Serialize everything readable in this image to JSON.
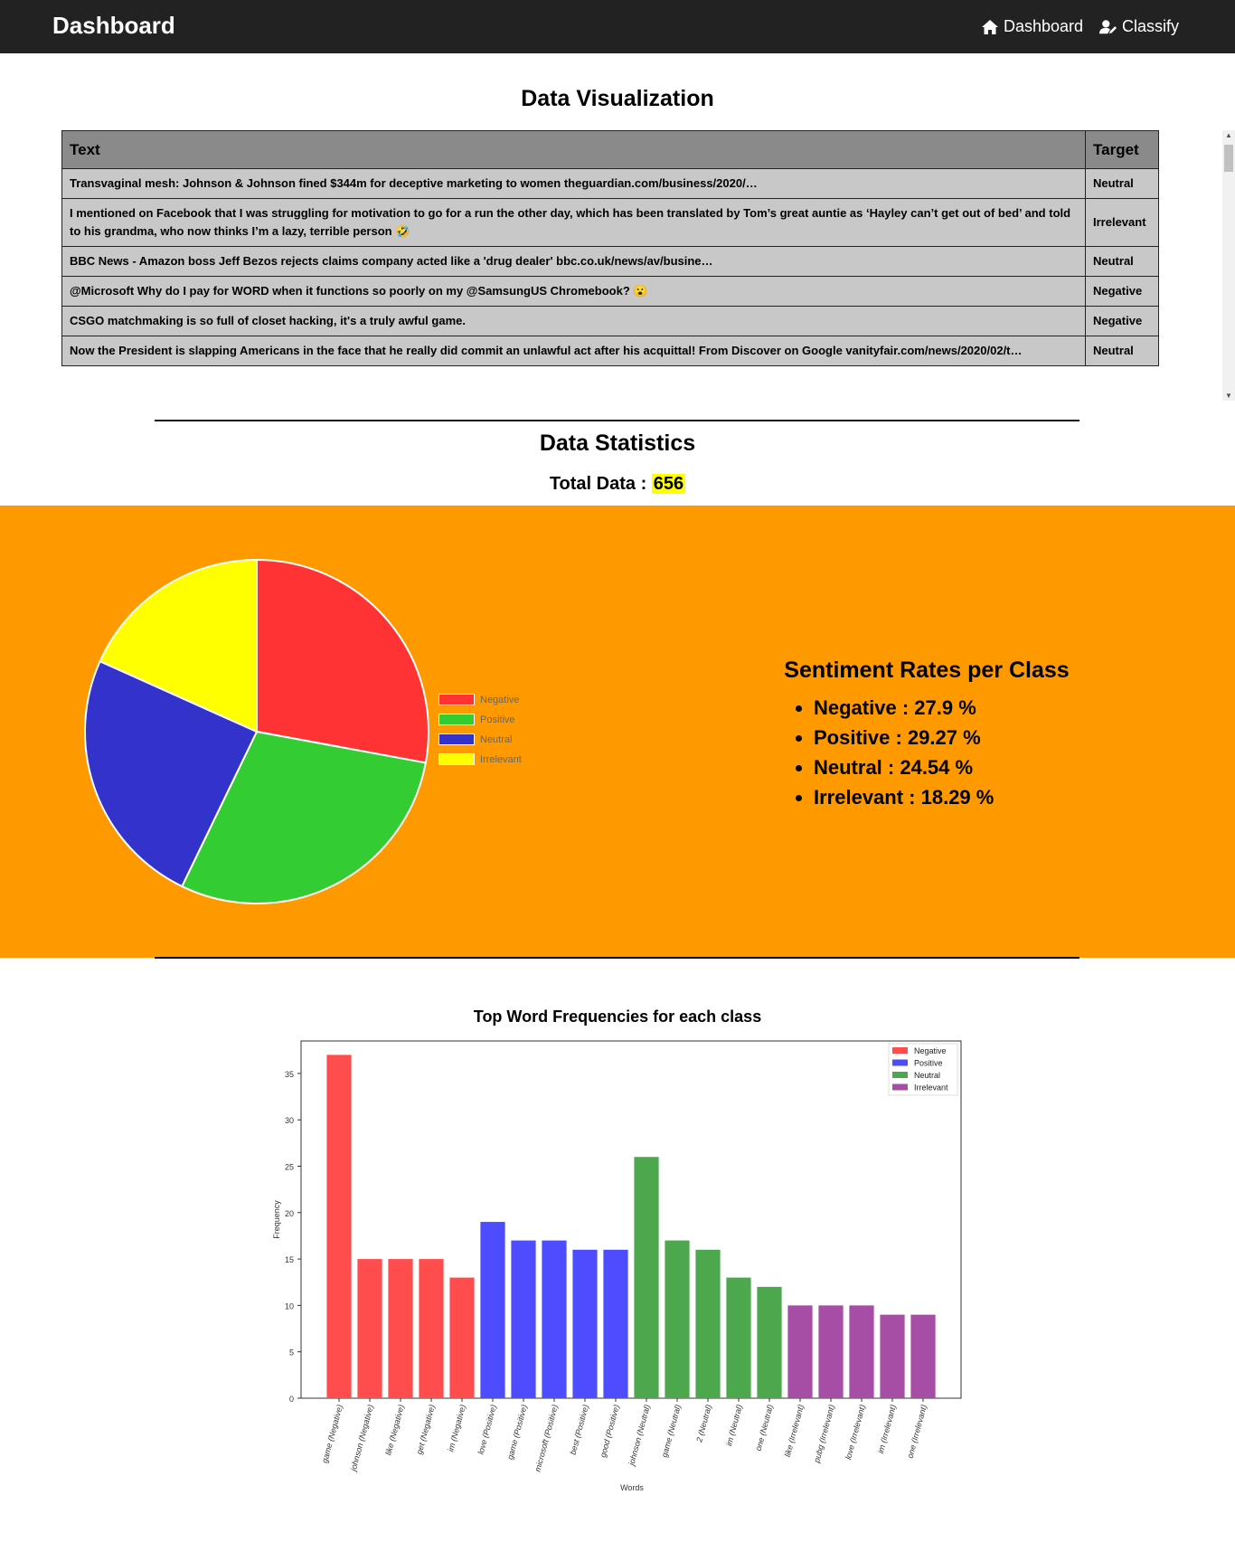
{
  "nav": {
    "brand": "Dashboard",
    "links": [
      {
        "label": "Dashboard",
        "icon": "home-icon"
      },
      {
        "label": "Classify",
        "icon": "user-edit-icon"
      }
    ]
  },
  "viz": {
    "title": "Data Visualization",
    "columns": [
      "Text",
      "Target"
    ],
    "rows": [
      {
        "text": "Transvaginal mesh: Johnson & Johnson fined $344m for deceptive marketing to women theguardian.com/business/2020/…",
        "target": "Neutral"
      },
      {
        "text": "I mentioned on Facebook that I was struggling for motivation to go for a run the other day, which has been translated by Tom’s great auntie as ‘Hayley can’t get out of bed’ and told to his grandma, who now thinks I’m a lazy, terrible person 🤣",
        "target": "Irrelevant"
      },
      {
        "text": "BBC News - Amazon boss Jeff Bezos rejects claims company acted like a 'drug dealer' bbc.co.uk/news/av/busine…",
        "target": "Neutral"
      },
      {
        "text": "@Microsoft Why do I pay for WORD when it functions so poorly on my @SamsungUS Chromebook? 😮",
        "target": "Negative"
      },
      {
        "text": "CSGO matchmaking is so full of closet hacking, it's a truly awful game.",
        "target": "Negative"
      },
      {
        "text": "Now the President is slapping Americans in the face that he really did commit an unlawful act after his acquittal! From Discover on Google vanityfair.com/news/2020/02/t…",
        "target": "Neutral"
      }
    ]
  },
  "stats": {
    "title": "Data Statistics",
    "total_label": "Total Data :",
    "total_value": "656"
  },
  "colors": {
    "nav": "#222222",
    "orange": "#ff9900",
    "highlight": "#ffff00"
  },
  "pie": {
    "chart_data": {
      "type": "pie",
      "labels": [
        "Negative",
        "Positive",
        "Neutral",
        "Irrelevant"
      ],
      "values": [
        27.9,
        29.27,
        24.54,
        18.29
      ],
      "colors": [
        "#ff3333",
        "#33cc33",
        "#3333cc",
        "#ffff00"
      ],
      "legend": "right"
    }
  },
  "rates": {
    "title": "Sentiment Rates per Class",
    "items": [
      "Negative : 27.9 %",
      "Positive : 29.27 %",
      "Neutral : 24.54 %",
      "Irrelevant : 18.29 %"
    ]
  },
  "chart_data": {
    "type": "bar",
    "title": "Top Word Frequencies for each class",
    "xlabel": "Words",
    "ylabel": "Frequency",
    "ylim": [
      0,
      38.5
    ],
    "yticks": [
      0,
      5,
      10,
      15,
      20,
      25,
      30,
      35
    ],
    "legend": "top-right",
    "series": [
      {
        "name": "Negative",
        "color": "#ff4d4d",
        "categories": [
          "game (Negative)",
          "johnson (Negative)",
          "like (Negative)",
          "get (Negative)",
          "im (Negative)"
        ],
        "values": [
          37,
          15,
          15,
          15,
          13
        ]
      },
      {
        "name": "Positive",
        "color": "#4d4dff",
        "categories": [
          "love (Positive)",
          "game (Positive)",
          "microsoft (Positive)",
          "best (Positive)",
          "good (Positive)"
        ],
        "values": [
          19,
          17,
          17,
          16,
          16
        ]
      },
      {
        "name": "Neutral",
        "color": "#4da84d",
        "categories": [
          "johnson (Neutral)",
          "game (Neutral)",
          "2 (Neutral)",
          "im (Neutral)",
          "one (Neutral)"
        ],
        "values": [
          26,
          17,
          16,
          13,
          12
        ]
      },
      {
        "name": "Irrelevant",
        "color": "#a64da6",
        "categories": [
          "like (Irrelevant)",
          "pubg (Irrelevant)",
          "love (Irrelevant)",
          "im (Irrelevant)",
          "one (Irrelevant)"
        ],
        "values": [
          10,
          10,
          10,
          9,
          9
        ]
      }
    ]
  }
}
